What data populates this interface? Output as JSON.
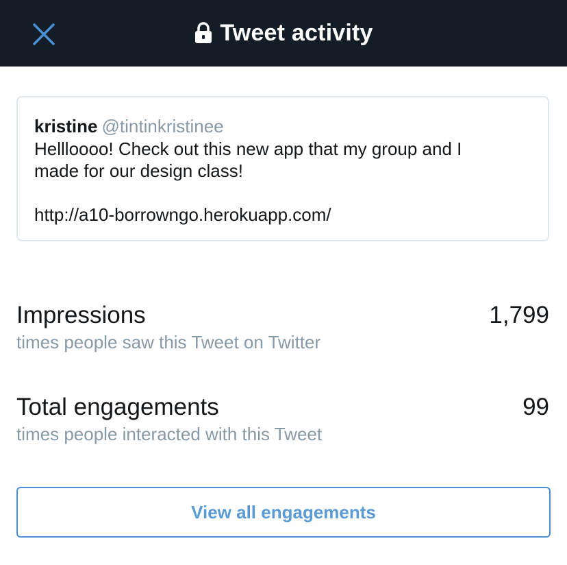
{
  "header": {
    "title": "Tweet activity",
    "close_icon": "close-icon",
    "lock_icon": "lock-icon",
    "background_color": "#141d26",
    "accent_color": "#4a90d9"
  },
  "tweet": {
    "author_name": "kristine",
    "author_handle": "@tintinkristinee",
    "text": "Hellloooo! Check out this new app that my group and I\nmade for our design class!",
    "link": "http://a10-borrowngo.herokuapp.com/"
  },
  "metrics": [
    {
      "label": "Impressions",
      "value": "1,799",
      "description": "times people saw this Tweet on Twitter"
    },
    {
      "label": "Total engagements",
      "value": "99",
      "description": "times people interacted with this Tweet"
    }
  ],
  "actions": {
    "view_all_label": "View all engagements"
  }
}
